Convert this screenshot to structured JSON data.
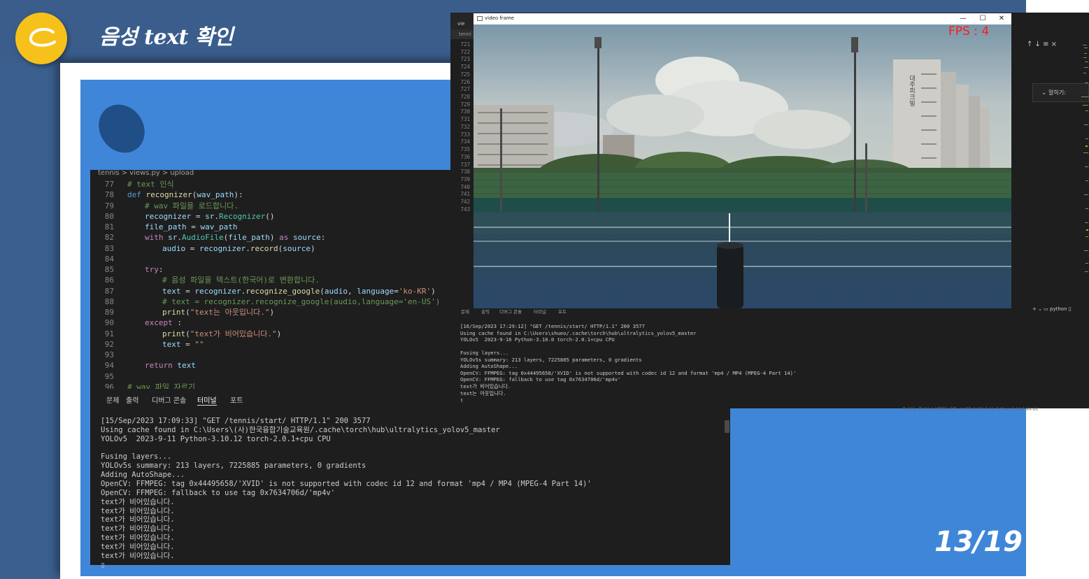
{
  "slide": {
    "title": "음성 text 확인",
    "page_number": "13/19"
  },
  "code_editor": {
    "breadcrumb": [
      "tennis",
      ">",
      "views.py",
      ">",
      "upload"
    ],
    "lines": [
      {
        "n": "77",
        "segments": [
          [
            "cm",
            "# text 인식"
          ]
        ],
        "indent": 0
      },
      {
        "n": "78",
        "segments": [
          [
            "kw",
            "def "
          ],
          [
            "fn",
            "recognizer"
          ],
          [
            "tx",
            "("
          ],
          [
            "vr",
            "wav_path"
          ],
          [
            "tx",
            "):"
          ]
        ],
        "indent": 0
      },
      {
        "n": "79",
        "segments": [
          [
            "cm",
            "# wav 파일을 로드합니다."
          ]
        ],
        "indent": 1
      },
      {
        "n": "80",
        "segments": [
          [
            "vr",
            "recognizer"
          ],
          [
            "tx",
            " = "
          ],
          [
            "vr",
            "sr"
          ],
          [
            "tx",
            "."
          ],
          [
            "cl",
            "Recognizer"
          ],
          [
            "tx",
            "()"
          ]
        ],
        "indent": 1
      },
      {
        "n": "81",
        "segments": [
          [
            "vr",
            "file_path"
          ],
          [
            "tx",
            " = "
          ],
          [
            "vr",
            "wav_path"
          ]
        ],
        "indent": 1
      },
      {
        "n": "82",
        "segments": [
          [
            "ctl",
            "with "
          ],
          [
            "vr",
            "sr"
          ],
          [
            "tx",
            "."
          ],
          [
            "cl",
            "AudioFile"
          ],
          [
            "tx",
            "("
          ],
          [
            "vr",
            "file_path"
          ],
          [
            "tx",
            ") "
          ],
          [
            "ctl",
            "as "
          ],
          [
            "vr",
            "source"
          ],
          [
            "tx",
            ":"
          ]
        ],
        "indent": 1
      },
      {
        "n": "83",
        "segments": [
          [
            "vr",
            "audio"
          ],
          [
            "tx",
            " = "
          ],
          [
            "vr",
            "recognizer"
          ],
          [
            "tx",
            "."
          ],
          [
            "fn",
            "record"
          ],
          [
            "tx",
            "("
          ],
          [
            "vr",
            "source"
          ],
          [
            "tx",
            ")"
          ]
        ],
        "indent": 2
      },
      {
        "n": "84",
        "segments": [],
        "indent": 0
      },
      {
        "n": "85",
        "segments": [
          [
            "ctl",
            "try"
          ],
          [
            "tx",
            ":"
          ]
        ],
        "indent": 1
      },
      {
        "n": "86",
        "segments": [
          [
            "cm",
            "# 음성 파일을 텍스트(한국어)로 변환합니다."
          ]
        ],
        "indent": 2
      },
      {
        "n": "87",
        "segments": [
          [
            "vr",
            "text"
          ],
          [
            "tx",
            " = "
          ],
          [
            "vr",
            "recognizer"
          ],
          [
            "tx",
            "."
          ],
          [
            "fn",
            "recognize_google"
          ],
          [
            "tx",
            "("
          ],
          [
            "vr",
            "audio"
          ],
          [
            "tx",
            ", "
          ],
          [
            "vr",
            "language"
          ],
          [
            "tx",
            "="
          ],
          [
            "st",
            "'ko-KR'"
          ],
          [
            "tx",
            ")"
          ]
        ],
        "indent": 2
      },
      {
        "n": "88",
        "segments": [
          [
            "cm",
            "# text = recognizer.recognize_google(audio,language='en-US')"
          ]
        ],
        "indent": 2
      },
      {
        "n": "89",
        "segments": [
          [
            "fn",
            "print"
          ],
          [
            "tx",
            "("
          ],
          [
            "st",
            "\"text는 아웃입니다.\""
          ],
          [
            "tx",
            ")"
          ]
        ],
        "indent": 2
      },
      {
        "n": "90",
        "segments": [
          [
            "ctl",
            "except "
          ],
          [
            "tx",
            ":"
          ]
        ],
        "indent": 1
      },
      {
        "n": "91",
        "segments": [
          [
            "fn",
            "print"
          ],
          [
            "tx",
            "("
          ],
          [
            "st",
            "\"text가 비어있습니다.\""
          ],
          [
            "tx",
            ")"
          ]
        ],
        "indent": 2
      },
      {
        "n": "92",
        "segments": [
          [
            "vr",
            "text"
          ],
          [
            "tx",
            " = "
          ],
          [
            "st",
            "\"\""
          ]
        ],
        "indent": 2
      },
      {
        "n": "93",
        "segments": [],
        "indent": 0
      },
      {
        "n": "94",
        "segments": [
          [
            "ctl",
            "return "
          ],
          [
            "vr",
            "text"
          ]
        ],
        "indent": 1
      },
      {
        "n": "95",
        "segments": [],
        "indent": 0
      },
      {
        "n": "96",
        "segments": [
          [
            "cm",
            "# wav 파일 자르기"
          ]
        ],
        "indent": 0
      }
    ]
  },
  "terminal": {
    "tabs": [
      "문제",
      "출력",
      "디버그 콘솔",
      "터미널",
      "포트"
    ],
    "active_tab": "터미널",
    "lines": [
      "[15/Sep/2023 17:09:33] \"GET /tennis/start/ HTTP/1.1\" 200 3577",
      "Using cache found in C:\\Users\\(사)한국융합기술교육원/.cache\\torch\\hub\\ultralytics_yolov5_master",
      "YOLOv5  2023-9-11 Python-3.10.12 torch-2.0.1+cpu CPU",
      "",
      "Fusing layers...",
      "YOLOv5s summary: 213 layers, 7225885 parameters, 0 gradients",
      "Adding AutoShape...",
      "OpenCV: FFMPEG: tag 0x44495658/'XVID' is not supported with codec id 12 and format 'mp4 / MP4 (MPEG-4 Part 14)'",
      "OpenCV: FFMPEG: fallback to use tag 0x7634706d/'mp4v'",
      "text가 비어있습니다.",
      "text가 비어있습니다.",
      "text가 비어있습니다.",
      "text가 비어있습니다.",
      "text가 비어있습니다.",
      "text가 비어있습니다.",
      "text가 비어있습니다.",
      "▯"
    ]
  },
  "right_vscode": {
    "tab_label": "vie",
    "tab_label2": "tenni",
    "gutter": [
      "721",
      "722",
      "723",
      "724",
      "725",
      "726",
      "727",
      "728",
      "729",
      "730",
      "731",
      "732",
      "733",
      "734",
      "735",
      "736",
      "737",
      "738",
      "739",
      "740",
      "741",
      "742",
      "743"
    ],
    "find_controls": "↑  ↓  ≡  ×",
    "chat_label": "말하기:",
    "terminal_tabs": [
      "문제",
      "출력",
      "디버그 콘솔",
      "터미널",
      "포트"
    ],
    "terminal_side": "+ ⌄  ▭ python  ▯",
    "terminal_lines": [
      "[16/Sep/2023 17:29:12] \"GET /tennis/start/ HTTP/1.1\" 200 3577",
      "Using cache found in C:\\Users\\shueo/.cache\\torch\\hub\\ultralytics_yolov5_master",
      "YOLOv5  2023-9-16 Python-3.10.0 torch-2.0.1+cpu CPU",
      "",
      "Fusing layers...",
      "YOLOv5s summary: 213 layers, 7225885 parameters, 0 gradients",
      "Adding AutoShape...",
      "OpenCV: FFMPEG: tag 0x44495658/'XVID' is not supported with codec id 12 and format 'mp4 / MP4 (MPEG-4 Part 14)'",
      "OpenCV: FFMPEG: fallback to use tag 0x7634706d/'mp4v'",
      "text가 비어있습니다.",
      "text는 아웃입니다.",
      "▯"
    ],
    "status_bar": "줄 615, 열 2(14 선택됨)   공백: 4   UTF-8   CRLF   {} Python   3.10.0 64-bit"
  },
  "video_window": {
    "title": "video frame",
    "fps_text": "FPS : 4",
    "controls": [
      "—",
      "☐",
      "✕"
    ],
    "building_sign": "대주피크빌"
  },
  "colors": {
    "slide_header": "#3a5d8c",
    "slide_blue": "#3f86d8",
    "logo_yellow": "#f7c11b",
    "fps_red": "#ff1a1a",
    "editor_bg": "#1e1e1e"
  }
}
